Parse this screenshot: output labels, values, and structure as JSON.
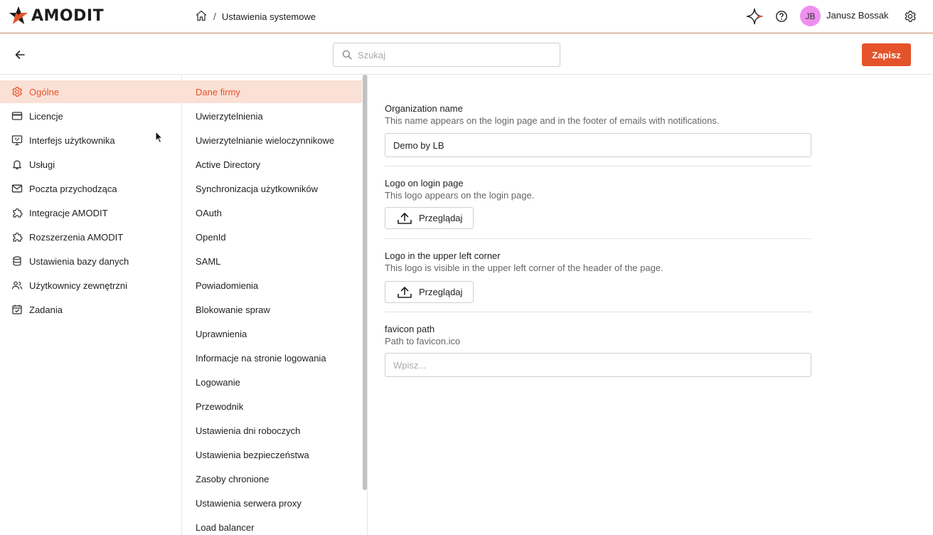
{
  "header": {
    "logo_text": "AMODIT",
    "breadcrumb_current": "Ustawienia systemowe",
    "breadcrumb_separator": "/",
    "avatar_initials": "JB",
    "user_name": "Janusz Bossak"
  },
  "toolbar": {
    "search_placeholder": "Szukaj",
    "save_label": "Zapisz"
  },
  "nav": {
    "items": [
      {
        "label": "Ogólne",
        "icon": "gear-icon",
        "active": true
      },
      {
        "label": "Licencje",
        "icon": "card-icon"
      },
      {
        "label": "Interfejs użytkownika",
        "icon": "monitor-icon"
      },
      {
        "label": "Usługi",
        "icon": "bell-icon"
      },
      {
        "label": "Poczta przychodząca",
        "icon": "mail-icon"
      },
      {
        "label": "Integracje AMODIT",
        "icon": "puzzle-icon"
      },
      {
        "label": "Rozszerzenia AMODIT",
        "icon": "puzzle-icon"
      },
      {
        "label": "Ustawienia bazy danych",
        "icon": "database-icon"
      },
      {
        "label": "Użytkownicy zewnętrzni",
        "icon": "users-icon"
      },
      {
        "label": "Zadania",
        "icon": "calendar-check-icon"
      }
    ]
  },
  "subnav": {
    "items": [
      {
        "label": "Dane firmy",
        "active": true
      },
      {
        "label": "Uwierzytelnienia"
      },
      {
        "label": "Uwierzytelnianie wieloczynnikowe"
      },
      {
        "label": "Active Directory"
      },
      {
        "label": "Synchronizacja użytkowników"
      },
      {
        "label": "OAuth"
      },
      {
        "label": "OpenId"
      },
      {
        "label": "SAML"
      },
      {
        "label": "Powiadomienia"
      },
      {
        "label": "Blokowanie spraw"
      },
      {
        "label": "Uprawnienia"
      },
      {
        "label": "Informacje na stronie logowania"
      },
      {
        "label": "Logowanie"
      },
      {
        "label": "Przewodnik"
      },
      {
        "label": "Ustawienia dni roboczych"
      },
      {
        "label": "Ustawienia bezpieczeństwa"
      },
      {
        "label": "Zasoby chronione"
      },
      {
        "label": "Ustawienia serwera proxy"
      },
      {
        "label": "Load balancer"
      }
    ]
  },
  "form": {
    "org_name": {
      "label": "Organization name",
      "description": "This name appears on the login page and in the footer of emails with notifications.",
      "value": "Demo by LB"
    },
    "logo_login": {
      "label": "Logo on login page",
      "description": "This logo appears on the login page.",
      "button_label": "Przeglądaj"
    },
    "logo_corner": {
      "label": "Logo in the upper left corner",
      "description": "This logo is visible in the upper left corner of the header of the page.",
      "button_label": "Przeglądaj"
    },
    "favicon": {
      "label": "favicon path",
      "description": "Path to favicon.ico",
      "placeholder": "Wpisz..."
    }
  },
  "colors": {
    "accent": "#e4532a",
    "active_bg": "#fbe0d6",
    "avatar_bg": "#ef8fee"
  }
}
